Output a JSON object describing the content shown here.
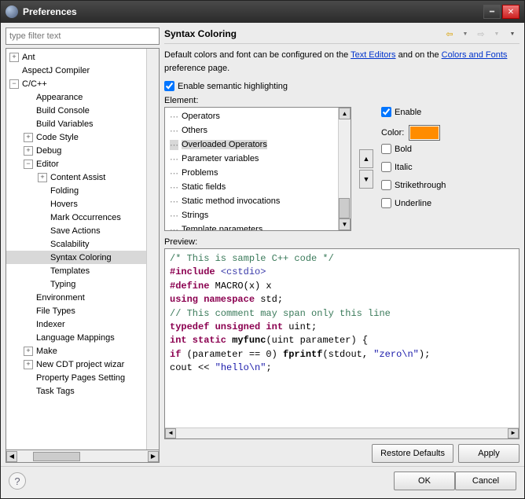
{
  "window": {
    "title": "Preferences"
  },
  "filter": {
    "placeholder": "type filter text"
  },
  "tree": [
    {
      "label": "Ant",
      "depth": 0,
      "expand": "plus"
    },
    {
      "label": "AspectJ Compiler",
      "depth": 0,
      "expand": "none"
    },
    {
      "label": "C/C++",
      "depth": 0,
      "expand": "minus"
    },
    {
      "label": "Appearance",
      "depth": 1,
      "expand": "none"
    },
    {
      "label": "Build Console",
      "depth": 1,
      "expand": "none"
    },
    {
      "label": "Build Variables",
      "depth": 1,
      "expand": "none"
    },
    {
      "label": "Code Style",
      "depth": 1,
      "expand": "plus"
    },
    {
      "label": "Debug",
      "depth": 1,
      "expand": "plus"
    },
    {
      "label": "Editor",
      "depth": 1,
      "expand": "minus"
    },
    {
      "label": "Content Assist",
      "depth": 2,
      "expand": "plus"
    },
    {
      "label": "Folding",
      "depth": 2,
      "expand": "none"
    },
    {
      "label": "Hovers",
      "depth": 2,
      "expand": "none"
    },
    {
      "label": "Mark Occurrences",
      "depth": 2,
      "expand": "none"
    },
    {
      "label": "Save Actions",
      "depth": 2,
      "expand": "none"
    },
    {
      "label": "Scalability",
      "depth": 2,
      "expand": "none"
    },
    {
      "label": "Syntax Coloring",
      "depth": 2,
      "expand": "none",
      "selected": true
    },
    {
      "label": "Templates",
      "depth": 2,
      "expand": "none"
    },
    {
      "label": "Typing",
      "depth": 2,
      "expand": "none"
    },
    {
      "label": "Environment",
      "depth": 1,
      "expand": "none"
    },
    {
      "label": "File Types",
      "depth": 1,
      "expand": "none"
    },
    {
      "label": "Indexer",
      "depth": 1,
      "expand": "none"
    },
    {
      "label": "Language Mappings",
      "depth": 1,
      "expand": "none"
    },
    {
      "label": "Make",
      "depth": 1,
      "expand": "plus"
    },
    {
      "label": "New CDT project wizar",
      "depth": 1,
      "expand": "plus"
    },
    {
      "label": "Property Pages Setting",
      "depth": 1,
      "expand": "none"
    },
    {
      "label": "Task Tags",
      "depth": 1,
      "expand": "none"
    }
  ],
  "section": {
    "title": "Syntax Coloring"
  },
  "desc": {
    "pre": "Default colors and font can be configured on the ",
    "link1": "Text Editors",
    "mid": " and on the ",
    "link2": "Colors and Fonts",
    "post": " preference page."
  },
  "semantic": {
    "label": "Enable semantic highlighting",
    "checked": true
  },
  "element_label": "Element:",
  "elements": [
    {
      "label": "Operators"
    },
    {
      "label": "Others"
    },
    {
      "label": "Overloaded Operators",
      "selected": true
    },
    {
      "label": "Parameter variables"
    },
    {
      "label": "Problems"
    },
    {
      "label": "Static fields"
    },
    {
      "label": "Static method invocations"
    },
    {
      "label": "Strings"
    },
    {
      "label": "Template parameters"
    }
  ],
  "style": {
    "enable": {
      "label": "Enable",
      "checked": true
    },
    "color_label": "Color:",
    "color": "#ff8c00",
    "bold": {
      "label": "Bold",
      "checked": false
    },
    "italic": {
      "label": "Italic",
      "checked": false
    },
    "strike": {
      "label": "Strikethrough",
      "checked": false
    },
    "underline": {
      "label": "Underline",
      "checked": false
    }
  },
  "preview_label": "Preview:",
  "preview": {
    "l1": "/* This is sample C++ code */",
    "l2a": "#include",
    "l2b": "<cstdio>",
    "l3a": "#define",
    "l3b": "MACRO(x) x",
    "l4a": "using namespace",
    "l4b": "std;",
    "l5": "// This comment may span only this line",
    "l6a": "typedef unsigned int",
    "l6b": "uint;",
    "l7a": "int static",
    "l7b": "myfunc",
    "l7c": "(uint parameter) {",
    "l8a": "   if",
    "l8b": "(parameter == 0)",
    "l8c": "fprintf",
    "l8d": "(stdout,",
    "l8e": "\"zero\\n\"",
    "l8f": ");",
    "l9a": "   cout <<",
    "l9b": "\"hello\\n\"",
    "l9c": ";"
  },
  "buttons": {
    "restore": "Restore Defaults",
    "apply": "Apply",
    "ok": "OK",
    "cancel": "Cancel"
  }
}
